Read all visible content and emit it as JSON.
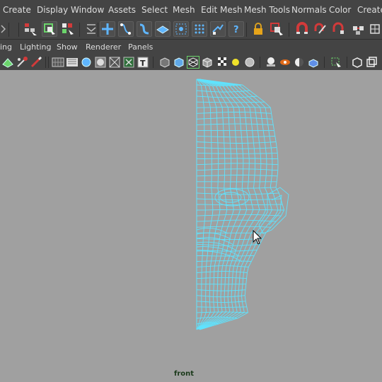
{
  "main_menu": [
    "Create",
    "Display",
    "Window",
    "Assets",
    "Select",
    "Mesh",
    "Edit Mesh",
    "Mesh Tools",
    "Normals",
    "Color",
    "Create"
  ],
  "panel_menu": [
    "ing",
    "Lighting",
    "Show",
    "Renderer",
    "Panels"
  ],
  "shelf_icons": [
    "select-by-hierarchy-icon",
    "select-by-object-icon",
    "select-by-component-icon",
    "menu-set-icon",
    "snap-to-grid-icon",
    "snap-to-curve-icon",
    "snap-to-point-icon",
    "snap-to-plane-icon",
    "make-live-icon",
    "history-icon",
    "render-icon",
    "help-icon",
    "lock-icon",
    "select-highlight-icon",
    "magnet-icon",
    "symmetry-icon",
    "soft-select-icon",
    "tweak-icon",
    "grid-icon"
  ],
  "panel_tools": [
    "camera-icon",
    "film-gate-icon",
    "smooth-shade-icon",
    "wireframe-on-shaded-icon",
    "textured-icon",
    "use-all-lights-icon",
    "shadows-icon",
    "xray-icon",
    "isolate-icon",
    "grid-toggle-icon",
    "resolution-gate-icon",
    "gate-mask-icon",
    "field-chart-icon",
    "safe-action-icon",
    "dof-icon",
    "motion-blur-icon",
    "ambient-occlusion-icon",
    "anti-alias-icon",
    "hud-icon",
    "display-icon",
    "layout-icon"
  ],
  "viewport": {
    "camera": "front",
    "wire_color": "#5fe4ff",
    "background": "#a0a0a0"
  },
  "colors": {
    "menu_bg": "#444444",
    "text": "#dedede",
    "accent_green": "#6bd46b",
    "accent_red": "#d23a3a"
  }
}
